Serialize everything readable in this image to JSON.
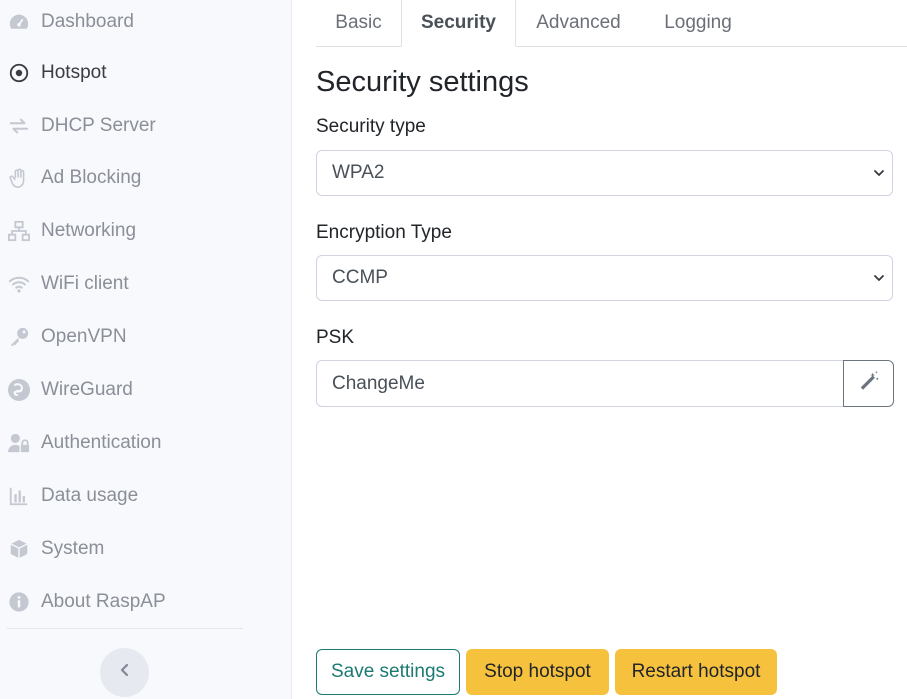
{
  "sidebar": {
    "items": [
      {
        "label": "Dashboard",
        "icon": "dashboard-icon"
      },
      {
        "label": "Hotspot",
        "icon": "dot-circle-icon",
        "active": true
      },
      {
        "label": "DHCP Server",
        "icon": "exchange-icon"
      },
      {
        "label": "Ad Blocking",
        "icon": "hand-icon"
      },
      {
        "label": "Networking",
        "icon": "network-icon"
      },
      {
        "label": "WiFi client",
        "icon": "wifi-icon"
      },
      {
        "label": "OpenVPN",
        "icon": "key-icon"
      },
      {
        "label": "WireGuard",
        "icon": "wireguard-icon"
      },
      {
        "label": "Authentication",
        "icon": "user-lock-icon"
      },
      {
        "label": "Data usage",
        "icon": "chart-bar-icon"
      },
      {
        "label": "System",
        "icon": "cube-icon"
      },
      {
        "label": "About RaspAP",
        "icon": "info-circle-icon"
      }
    ],
    "collapse_icon": "chevron-left-icon"
  },
  "tabs": [
    {
      "label": "Basic"
    },
    {
      "label": "Security",
      "active": true
    },
    {
      "label": "Advanced"
    },
    {
      "label": "Logging"
    }
  ],
  "content": {
    "heading": "Security settings",
    "security_type": {
      "label": "Security type",
      "value": "WPA2"
    },
    "encryption_type": {
      "label": "Encryption Type",
      "value": "CCMP"
    },
    "psk": {
      "label": "PSK",
      "value": "ChangeMe",
      "button_icon": "magic-wand-icon"
    }
  },
  "actions": {
    "save": "Save settings",
    "stop": "Stop hotspot",
    "restart": "Restart hotspot"
  },
  "colors": {
    "accent": "#1c7a72",
    "warning": "#f6c23e",
    "sidebar_bg": "#f8f9fc"
  }
}
